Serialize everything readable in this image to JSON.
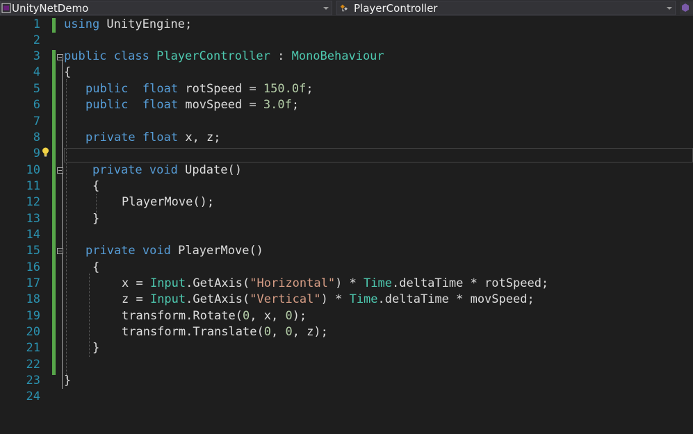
{
  "navbar": {
    "project_dropdown": "UnityNetDemo",
    "class_dropdown": "PlayerController"
  },
  "editor": {
    "line_numbers": [
      "1",
      "2",
      "3",
      "4",
      "5",
      "6",
      "7",
      "8",
      "9",
      "10",
      "11",
      "12",
      "13",
      "14",
      "15",
      "16",
      "17",
      "18",
      "19",
      "20",
      "21",
      "22",
      "23",
      "24"
    ],
    "lines": {
      "l1": {
        "t0": "using",
        "t1": " UnityEngine;"
      },
      "l3": {
        "t0": "public",
        "t1": " ",
        "t2": "class",
        "t3": " ",
        "t4": "PlayerController",
        "t5": " : ",
        "t6": "MonoBehaviour"
      },
      "l4": {
        "t0": "{"
      },
      "l5": {
        "t0": "public",
        "t1": "  ",
        "t2": "float",
        "t3": " rotSpeed = ",
        "t4": "150.0f",
        "t5": ";"
      },
      "l6": {
        "t0": "public",
        "t1": "  ",
        "t2": "float",
        "t3": " movSpeed = ",
        "t4": "3.0f",
        "t5": ";"
      },
      "l8": {
        "t0": "private",
        "t1": " ",
        "t2": "float",
        "t3": " x, z;"
      },
      "l10": {
        "t0": "private",
        "t1": " ",
        "t2": "void",
        "t3": " Update()"
      },
      "l11": {
        "t0": "{"
      },
      "l12": {
        "t0": "PlayerMove();"
      },
      "l13": {
        "t0": "}"
      },
      "l15": {
        "t0": "private",
        "t1": " ",
        "t2": "void",
        "t3": " PlayerMove()"
      },
      "l16": {
        "t0": "{"
      },
      "l17": {
        "t0": "x = ",
        "t1": "Input",
        "t2": ".GetAxis(",
        "t3": "\"Horizontal\"",
        "t4": ") * ",
        "t5": "Time",
        "t6": ".deltaTime * rotSpeed;"
      },
      "l18": {
        "t0": "z = ",
        "t1": "Input",
        "t2": ".GetAxis(",
        "t3": "\"Vertical\"",
        "t4": ") * ",
        "t5": "Time",
        "t6": ".deltaTime * movSpeed;"
      },
      "l19": {
        "t0": "transform.Rotate(",
        "t1": "0",
        "t2": ", x, ",
        "t3": "0",
        "t4": ");"
      },
      "l20": {
        "t0": "transform.Translate(",
        "t1": "0",
        "t2": ", ",
        "t3": "0",
        "t4": ", z);"
      },
      "l21": {
        "t0": "}"
      },
      "l23": {
        "t0": "}"
      }
    }
  },
  "colors": {
    "background": "#1e1e1e",
    "keyword": "#569cd6",
    "type": "#4ec9b0",
    "string": "#d69d85",
    "number": "#b5cea8",
    "line_number": "#2b91af",
    "change_indicator": "#57a64a"
  },
  "icons": [
    "csharp-project-icon",
    "class-component-icon",
    "lightbulb-icon",
    "outline-collapse-icon"
  ]
}
